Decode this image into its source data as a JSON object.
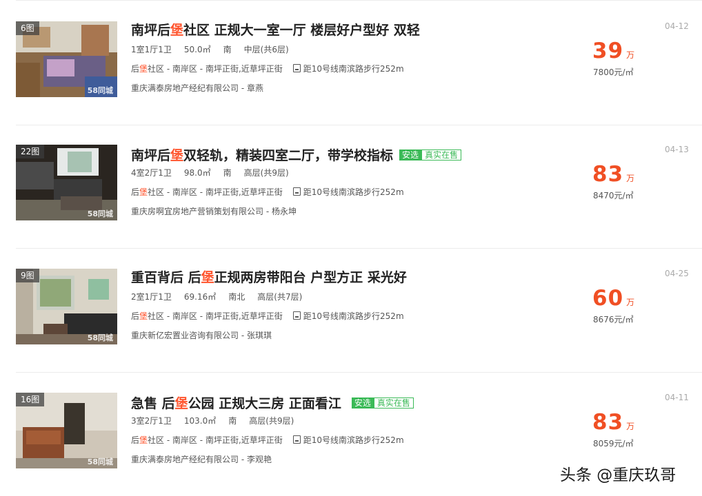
{
  "listings": [
    {
      "photo_count": "6图",
      "watermark": "58同城",
      "title_pre": "南坪后",
      "title_hl": "堡",
      "title_post": "社区 正规大一室一厅 楼层好户型好 双轻",
      "tags": [],
      "specs": {
        "layout": "1室1厅1卫",
        "area": "50.0㎡",
        "orientation": "南",
        "floor": "中层(共6层)"
      },
      "addr_pre": "后",
      "addr_hl": "堡",
      "addr_post": "社区 - 南岸区 - 南坪正街,近草坪正街",
      "subway": "距10号线南滨路步行252m",
      "agent": "重庆满泰房地产经纪有限公司 - 章燕",
      "price": "39",
      "price_unit": "万",
      "unit_price": "7800元/㎡",
      "date": "04-12"
    },
    {
      "photo_count": "22图",
      "watermark": "58同城",
      "title_pre": "南坪后",
      "title_hl": "堡",
      "title_post": "双轻轨，精装四室二厅，带学校指标",
      "tags": [
        "安选",
        "真实在售"
      ],
      "specs": {
        "layout": "4室2厅1卫",
        "area": "98.0㎡",
        "orientation": "南",
        "floor": "高层(共9层)"
      },
      "addr_pre": "后",
      "addr_hl": "堡",
      "addr_post": "社区 - 南岸区 - 南坪正街,近草坪正街",
      "subway": "距10号线南滨路步行252m",
      "agent": "重庆房啊宜房地产营销策划有限公司 - 杨永坤",
      "price": "83",
      "price_unit": "万",
      "unit_price": "8470元/㎡",
      "date": "04-13"
    },
    {
      "photo_count": "9图",
      "watermark": "58同城",
      "title_pre": "重百背后 后",
      "title_hl": "堡",
      "title_post": "正规两房带阳台 户型方正 采光好",
      "tags": [],
      "specs": {
        "layout": "2室1厅1卫",
        "area": "69.16㎡",
        "orientation": "南北",
        "floor": "高层(共7层)"
      },
      "addr_pre": "后",
      "addr_hl": "堡",
      "addr_post": "社区 - 南岸区 - 南坪正街,近草坪正街",
      "subway": "距10号线南滨路步行252m",
      "agent": "重庆新亿宏置业咨询有限公司 - 张琪琪",
      "price": "60",
      "price_unit": "万",
      "unit_price": "8676元/㎡",
      "date": "04-25"
    },
    {
      "photo_count": "16图",
      "watermark": "58同城",
      "title_pre": "急售 后",
      "title_hl": "堡",
      "title_post": "公园 正规大三房 正面看江",
      "tags": [
        "安选",
        "真实在售"
      ],
      "specs": {
        "layout": "3室2厅1卫",
        "area": "103.0㎡",
        "orientation": "南",
        "floor": "高层(共9层)"
      },
      "addr_pre": "后",
      "addr_hl": "堡",
      "addr_post": "社区 - 南岸区 - 南坪正街,近草坪正街",
      "subway": "距10号线南滨路步行252m",
      "agent": "重庆满泰房地产经纪有限公司 - 李观艳",
      "price": "83",
      "price_unit": "万",
      "unit_price": "8059元/㎡",
      "date": "04-11"
    }
  ],
  "credit": "头条 @重庆玖哥",
  "colors": {
    "highlight": "#ff552e",
    "price": "#f04f24",
    "tag_green": "#3bba57"
  }
}
